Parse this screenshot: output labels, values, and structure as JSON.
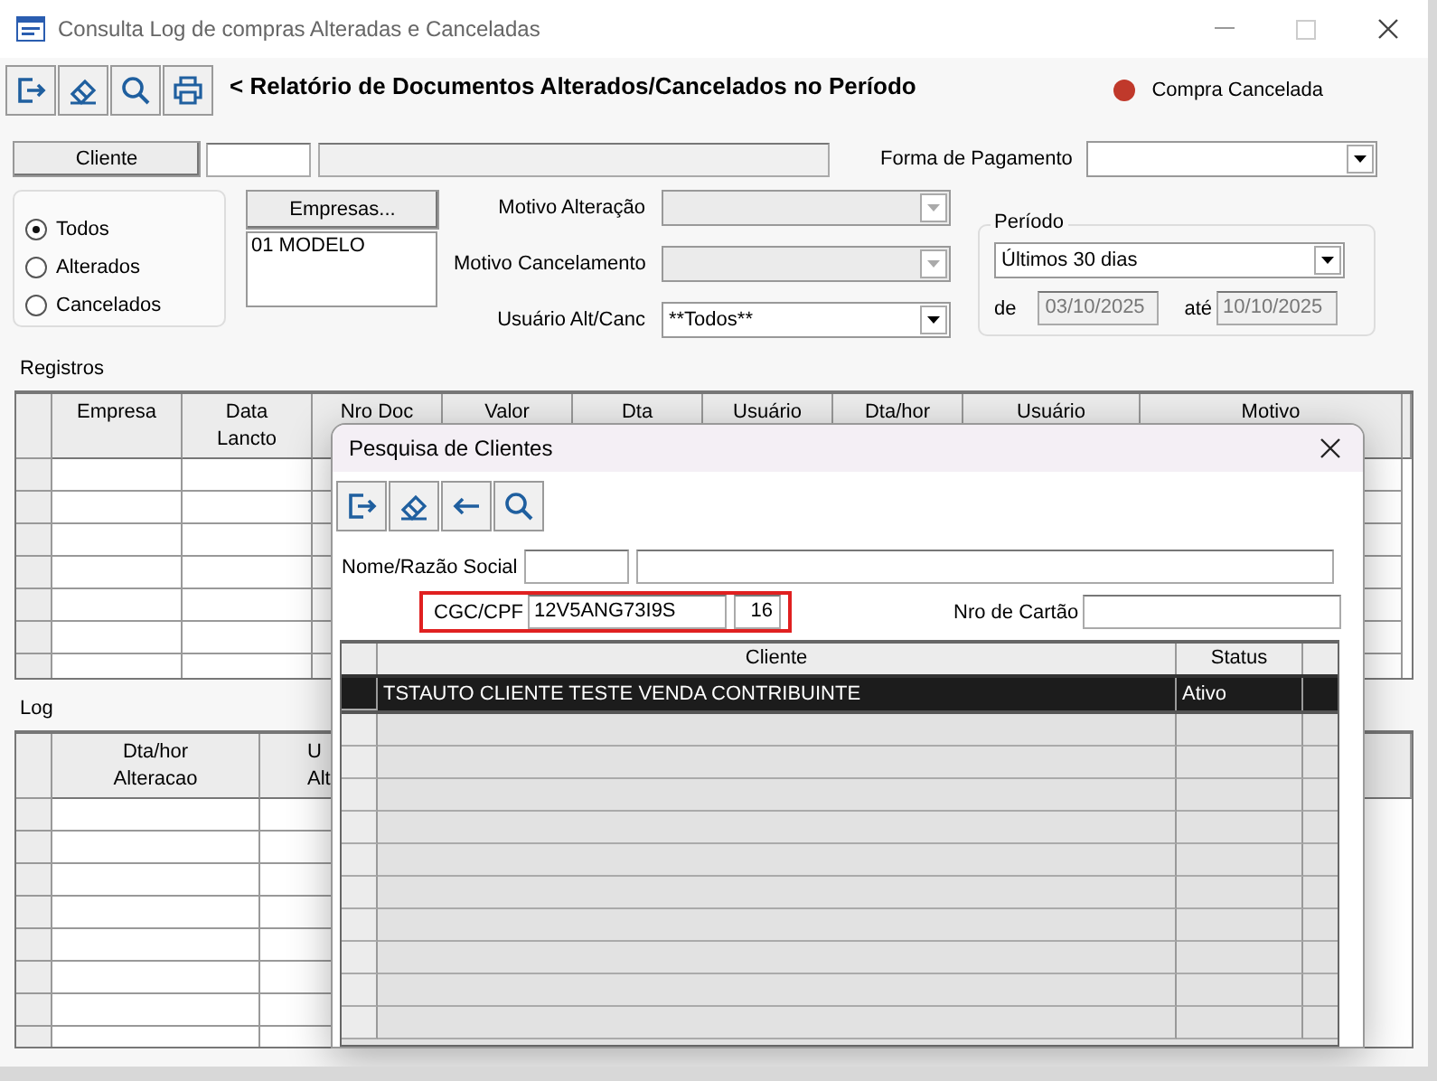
{
  "window": {
    "title": "Consulta Log de compras Alteradas e Canceladas"
  },
  "report_title": "< Relatório de Documentos Alterados/Cancelados no Período",
  "legend": [
    {
      "label": "Compra Cancelada",
      "color": "#c0392b"
    }
  ],
  "cliente": {
    "button": "Cliente"
  },
  "forma_pagamento": {
    "label": "Forma de Pagamento"
  },
  "situacao": [
    {
      "label": "Todos",
      "selected": true
    },
    {
      "label": "Alterados",
      "selected": false
    },
    {
      "label": "Cancelados",
      "selected": false
    }
  ],
  "empresas": {
    "button": "Empresas...",
    "items": [
      "01 MODELO"
    ]
  },
  "motivos": [
    {
      "label": "Motivo Alteração",
      "disabled": true
    },
    {
      "label": "Motivo Cancelamento",
      "disabled": true
    },
    {
      "label": "Usuário Alt/Canc",
      "value": "**Todos**",
      "disabled": false
    }
  ],
  "periodo": {
    "title": "Período",
    "value": "Últimos 30 dias",
    "de_label": "de",
    "de_value": "03/10/2025",
    "ate_label": "até",
    "ate_value": "10/10/2025",
    "dates_disabled": true
  },
  "registros": {
    "title": "Registros",
    "columns": [
      [
        "Empresa"
      ],
      [
        "Data",
        "Lancto"
      ],
      [
        "Nro Doc"
      ],
      [
        "Valor"
      ],
      [
        "Dta"
      ],
      [
        "Usuário"
      ],
      [
        "Dta/hor"
      ],
      [
        "Usuário"
      ],
      [
        "Motivo"
      ]
    ]
  },
  "log": {
    "title": "Log",
    "columns": [
      [
        "Dta/hor",
        "Alteracao"
      ],
      [
        "U",
        "Alt"
      ]
    ]
  },
  "dialog": {
    "title": "Pesquisa de Clientes",
    "nome_label": "Nome/Razão Social",
    "cgc_label": "CGC/CPF",
    "cgc_value": "12V5ANG73I9S",
    "cgc_digit": "16",
    "cartao_label": "Nro de Cartão",
    "columns": [
      "Cliente",
      "Status"
    ],
    "rows": [
      {
        "cliente": "TSTAUTO CLIENTE TESTE VENDA CONTRIBUINTE",
        "status": "Ativo",
        "selected": true
      }
    ]
  }
}
